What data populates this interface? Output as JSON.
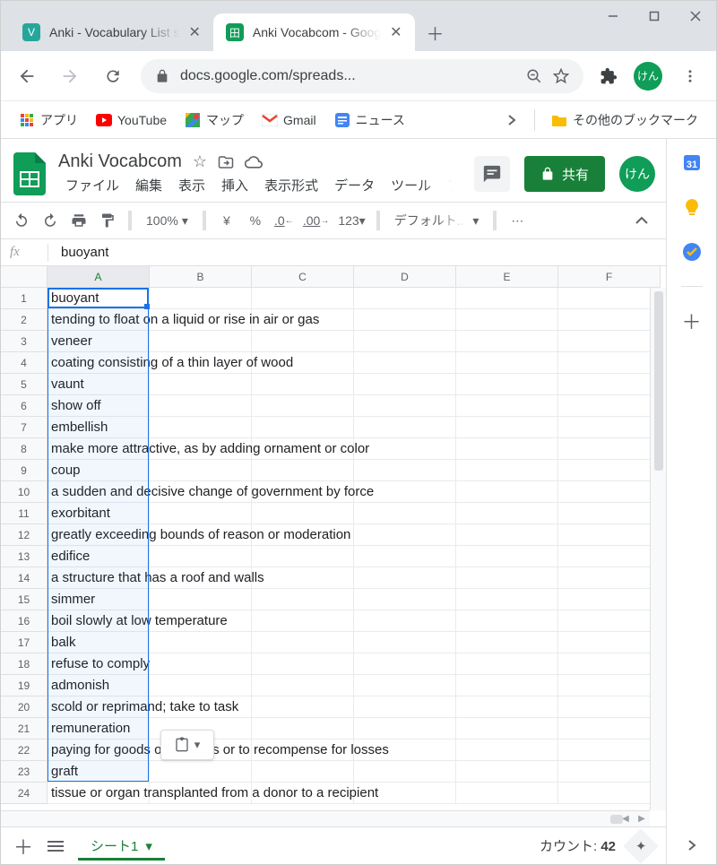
{
  "browser": {
    "tabs": [
      {
        "title": "Anki - Vocabulary List s",
        "favicon": "V"
      },
      {
        "title": "Anki Vocabcom - Goog",
        "favicon": "田"
      }
    ],
    "url": "docs.google.com/spreads...",
    "profile": "けん",
    "bookmarks": {
      "apps": "アプリ",
      "youtube": "YouTube",
      "maps": "マップ",
      "gmail": "Gmail",
      "news": "ニュース",
      "other": "その他のブックマーク"
    }
  },
  "sheets": {
    "title": "Anki Vocabcom",
    "menus": [
      "ファイル",
      "編集",
      "表示",
      "挿入",
      "表示形式",
      "データ",
      "ツール",
      "アド"
    ],
    "share": "共有",
    "zoom": "100%",
    "currency": "¥",
    "percent": "%",
    "dec_dec": ".0",
    "dec_inc": ".00",
    "numfmt": "123",
    "font": "デフォルト...",
    "fx_value": "buoyant",
    "columns": [
      "A",
      "B",
      "C",
      "D",
      "E",
      "F"
    ],
    "rows": [
      "buoyant",
      "tending to float on a liquid or rise in air or gas",
      "veneer",
      "coating consisting of a thin layer of wood",
      "vaunt",
      "show off",
      "embellish",
      "make more attractive, as by adding ornament or color",
      "coup",
      "a sudden and decisive change of government by force",
      "exorbitant",
      "greatly exceeding bounds of reason or moderation",
      "edifice",
      "a structure that has a roof and walls",
      "simmer",
      "boil slowly at low temperature",
      "balk",
      "refuse to comply",
      "admonish",
      "scold or reprimand; take to task",
      "remuneration",
      "paying for goods or services or to recompense for losses",
      "graft",
      "tissue or organ transplanted from a donor to a recipient"
    ],
    "sheet_tab": "シート1",
    "count_label": "カウント:",
    "count_value": "42"
  }
}
